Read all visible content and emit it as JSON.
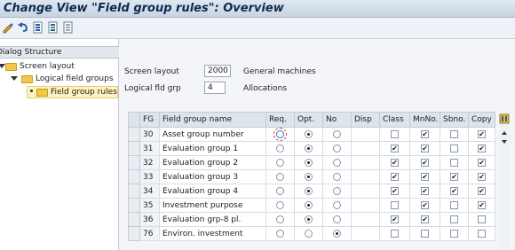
{
  "window": {
    "title": "Change View \"Field group rules\": Overview"
  },
  "toolbar": {
    "icons": [
      "display-change-icon",
      "undo-icon",
      "select-all-icon",
      "select-block-icon",
      "deselect-all-icon"
    ]
  },
  "dialog_structure": {
    "header": "Dialog Structure",
    "items": [
      {
        "label": "Screen layout",
        "level": 1,
        "expanded": true
      },
      {
        "label": "Logical field groups",
        "level": 2,
        "expanded": true
      },
      {
        "label": "Field group rules",
        "level": 3,
        "selected": true
      }
    ]
  },
  "header_fields": {
    "screen_layout": {
      "label": "Screen layout",
      "value": "2000",
      "description": "General machines"
    },
    "logical_fld_grp": {
      "label": "Logical fld grp",
      "value": "4",
      "description": "Allocations"
    }
  },
  "table": {
    "columns": [
      "FG",
      "Field group name",
      "Req.",
      "Opt.",
      "No",
      "Disp",
      "Class",
      "MnNo.",
      "Sbno.",
      "Copy"
    ],
    "rows": [
      {
        "fg": "30",
        "name": "Asset group number",
        "choice": "opt",
        "focus_req": true,
        "disp_radio": false,
        "klass": false,
        "mnno": true,
        "sbno": false,
        "copy": true
      },
      {
        "fg": "31",
        "name": "Evaluation group 1",
        "choice": "opt",
        "focus_req": false,
        "disp_radio": false,
        "klass": true,
        "mnno": true,
        "sbno": false,
        "copy": true
      },
      {
        "fg": "32",
        "name": "Evaluation group 2",
        "choice": "opt",
        "focus_req": false,
        "disp_radio": false,
        "klass": true,
        "mnno": true,
        "sbno": false,
        "copy": true
      },
      {
        "fg": "33",
        "name": "Evaluation group 3",
        "choice": "opt",
        "focus_req": false,
        "disp_radio": false,
        "klass": true,
        "mnno": true,
        "sbno": true,
        "copy": true
      },
      {
        "fg": "34",
        "name": "Evaluation group 4",
        "choice": "opt",
        "focus_req": false,
        "disp_radio": false,
        "klass": true,
        "mnno": true,
        "sbno": true,
        "copy": true
      },
      {
        "fg": "35",
        "name": "Investment purpose",
        "choice": "opt",
        "focus_req": false,
        "disp_radio": false,
        "klass": false,
        "mnno": true,
        "sbno": false,
        "copy": true
      },
      {
        "fg": "36",
        "name": "Evaluation grp-8 pl.",
        "choice": "opt",
        "focus_req": false,
        "disp_radio": false,
        "klass": true,
        "mnno": true,
        "sbno": false,
        "copy": false
      },
      {
        "fg": "76",
        "name": "Environ. investment",
        "choice": "no",
        "focus_req": false,
        "disp_radio": false,
        "klass": false,
        "mnno": false,
        "sbno": false,
        "copy": false
      }
    ]
  },
  "colors": {
    "title_text": "#0f2a4d",
    "folder": "#f2c64a",
    "selected_node": "#fdf2c0",
    "focus_outline": "#e04020"
  }
}
